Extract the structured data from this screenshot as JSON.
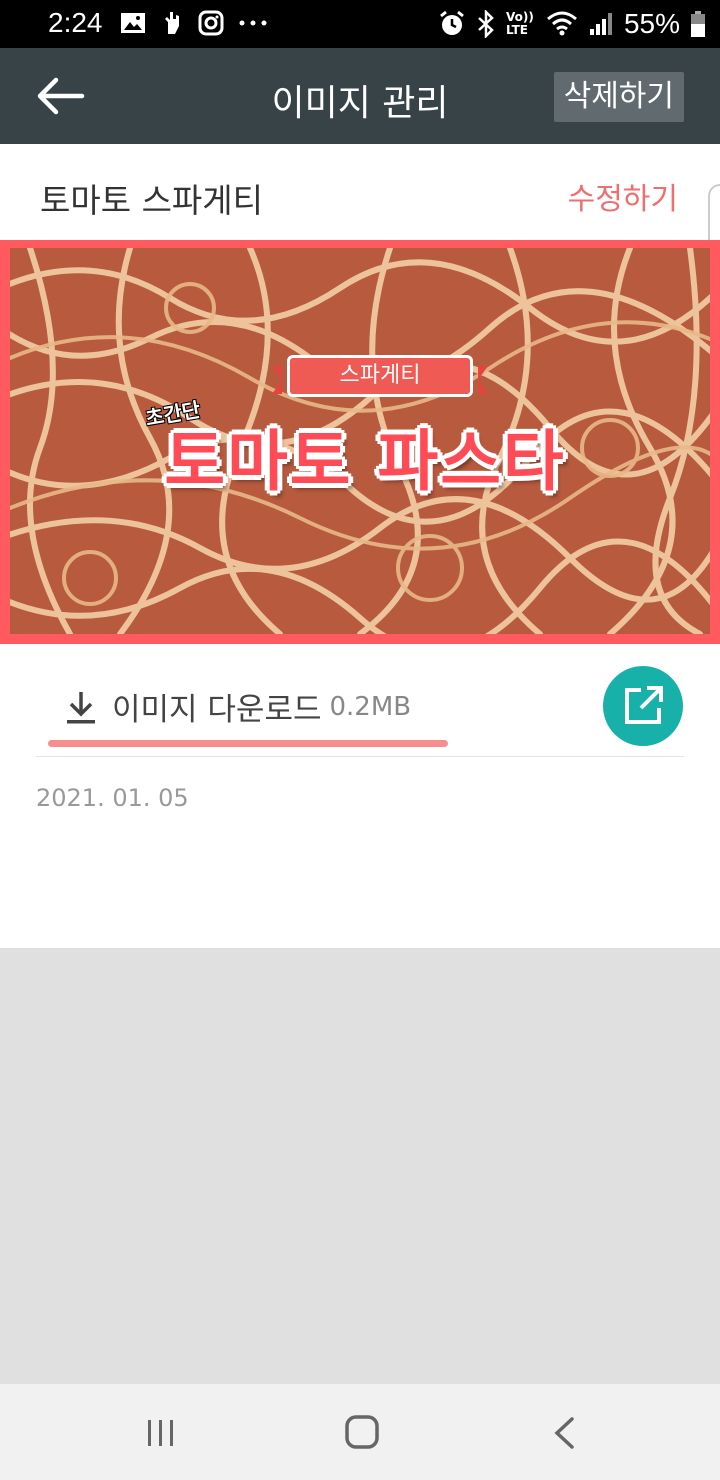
{
  "status_bar": {
    "time": "2:24",
    "battery": "55%",
    "left_icons": [
      "image-icon",
      "hand-icon",
      "instagram-icon",
      "more-dots-icon"
    ],
    "right_icons": [
      "alarm-icon",
      "bluetooth-icon",
      "volte-icon",
      "wifi-icon",
      "signal-icon",
      "battery-icon"
    ],
    "volte_text": "Vo)) LTE"
  },
  "app_bar": {
    "title": "이미지 관리",
    "delete_label": "삭제하기"
  },
  "item": {
    "title": "토마토 스파게티",
    "edit_label": "수정하기"
  },
  "image": {
    "ribbon_text": "스파게티",
    "small_text": "초간단",
    "big_text": "토마토 파스타"
  },
  "download": {
    "label": "이미지 다운로드",
    "size": "0.2MB"
  },
  "date": "2021. 01. 05",
  "colors": {
    "app_bar": "#384348",
    "accent_red": "#ff5a5f",
    "edit_text": "#f06e70",
    "teal": "#17b1aa"
  }
}
